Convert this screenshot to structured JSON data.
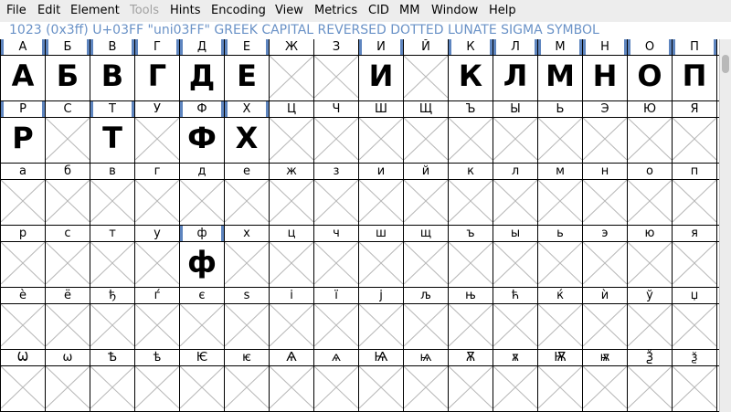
{
  "menubar": {
    "items": [
      {
        "label": "File",
        "enabled": true
      },
      {
        "label": "Edit",
        "enabled": true
      },
      {
        "label": "Element",
        "enabled": true
      },
      {
        "label": "Tools",
        "enabled": false
      },
      {
        "label": "Hints",
        "enabled": true
      },
      {
        "label": "Encoding",
        "enabled": true
      },
      {
        "label": "View",
        "enabled": true
      },
      {
        "label": "Metrics",
        "enabled": true
      },
      {
        "label": "CID",
        "enabled": true
      },
      {
        "label": "MM",
        "enabled": true
      },
      {
        "label": "Window",
        "enabled": true
      },
      {
        "label": "Help",
        "enabled": true
      }
    ]
  },
  "status": {
    "text": "1023 (0x3ff) U+03FF \"uni03FF\" GREEK CAPITAL REVERSED DOTTED LUNATE SIGMA SYMBOL"
  },
  "colors": {
    "status_text": "#6a92c7",
    "selection": "#5e85bf",
    "grid": "#000000",
    "empty_cross": "#b8b8b8"
  },
  "font_view": {
    "rows": [
      {
        "labels": [
          "А",
          "Б",
          "В",
          "Г",
          "Д",
          "Е",
          "Ж",
          "З",
          "И",
          "Й",
          "К",
          "Л",
          "М",
          "Н",
          "О",
          "П"
        ],
        "glyphs": [
          "А",
          "Б",
          "В",
          "Г",
          "Д",
          "Е",
          "",
          "",
          "И",
          "",
          "К",
          "Л",
          "М",
          "Н",
          "О",
          "П"
        ],
        "marked": [
          true,
          true,
          true,
          true,
          true,
          true,
          false,
          false,
          true,
          false,
          true,
          true,
          true,
          true,
          true,
          true
        ]
      },
      {
        "labels": [
          "Р",
          "С",
          "Т",
          "У",
          "Ф",
          "Х",
          "Ц",
          "Ч",
          "Ш",
          "Щ",
          "Ъ",
          "Ы",
          "Ь",
          "Э",
          "Ю",
          "Я"
        ],
        "glyphs": [
          "Р",
          "",
          "Т",
          "",
          "Ф",
          "Х",
          "",
          "",
          "",
          "",
          "",
          "",
          "",
          "",
          "",
          ""
        ],
        "marked": [
          true,
          false,
          true,
          false,
          true,
          true,
          false,
          false,
          false,
          false,
          false,
          false,
          false,
          false,
          false,
          false
        ]
      },
      {
        "labels": [
          "а",
          "б",
          "в",
          "г",
          "д",
          "е",
          "ж",
          "з",
          "и",
          "й",
          "к",
          "л",
          "м",
          "н",
          "о",
          "п"
        ],
        "glyphs": [
          "",
          "",
          "",
          "",
          "",
          "",
          "",
          "",
          "",
          "",
          "",
          "",
          "",
          "",
          "",
          ""
        ],
        "marked": [
          false,
          false,
          false,
          false,
          false,
          false,
          false,
          false,
          false,
          false,
          false,
          false,
          false,
          false,
          false,
          false
        ]
      },
      {
        "labels": [
          "р",
          "с",
          "т",
          "у",
          "ф",
          "х",
          "ц",
          "ч",
          "ш",
          "щ",
          "ъ",
          "ы",
          "ь",
          "э",
          "ю",
          "я"
        ],
        "glyphs": [
          "",
          "",
          "",
          "",
          "ф",
          "",
          "",
          "",
          "",
          "",
          "",
          "",
          "",
          "",
          "",
          ""
        ],
        "marked": [
          false,
          false,
          false,
          false,
          true,
          false,
          false,
          false,
          false,
          false,
          false,
          false,
          false,
          false,
          false,
          false
        ]
      },
      {
        "labels": [
          "è",
          "ё",
          "ђ",
          "ѓ",
          "є",
          "s",
          "і",
          "ї",
          "j",
          "љ",
          "њ",
          "ћ",
          "ќ",
          "ѝ",
          "ў",
          "џ"
        ],
        "glyphs": [
          "",
          "",
          "",
          "",
          "",
          "",
          "",
          "",
          "",
          "",
          "",
          "",
          "",
          "",
          "",
          ""
        ],
        "marked": [
          false,
          false,
          false,
          false,
          false,
          false,
          false,
          false,
          false,
          false,
          false,
          false,
          false,
          false,
          false,
          false
        ]
      },
      {
        "labels": [
          "Ѡ",
          "ѡ",
          "Ѣ",
          "ѣ",
          "Ѥ",
          "ѥ",
          "Ѧ",
          "ѧ",
          "Ѩ",
          "ѩ",
          "Ѫ",
          "ѫ",
          "Ѭ",
          "ѭ",
          "Ѯ",
          "ѯ"
        ],
        "glyphs": [
          "",
          "",
          "",
          "",
          "",
          "",
          "",
          "",
          "",
          "",
          "",
          "",
          "",
          "",
          "",
          ""
        ],
        "marked": [
          false,
          false,
          false,
          false,
          false,
          false,
          false,
          false,
          false,
          false,
          false,
          false,
          false,
          false,
          false,
          false
        ]
      }
    ]
  }
}
